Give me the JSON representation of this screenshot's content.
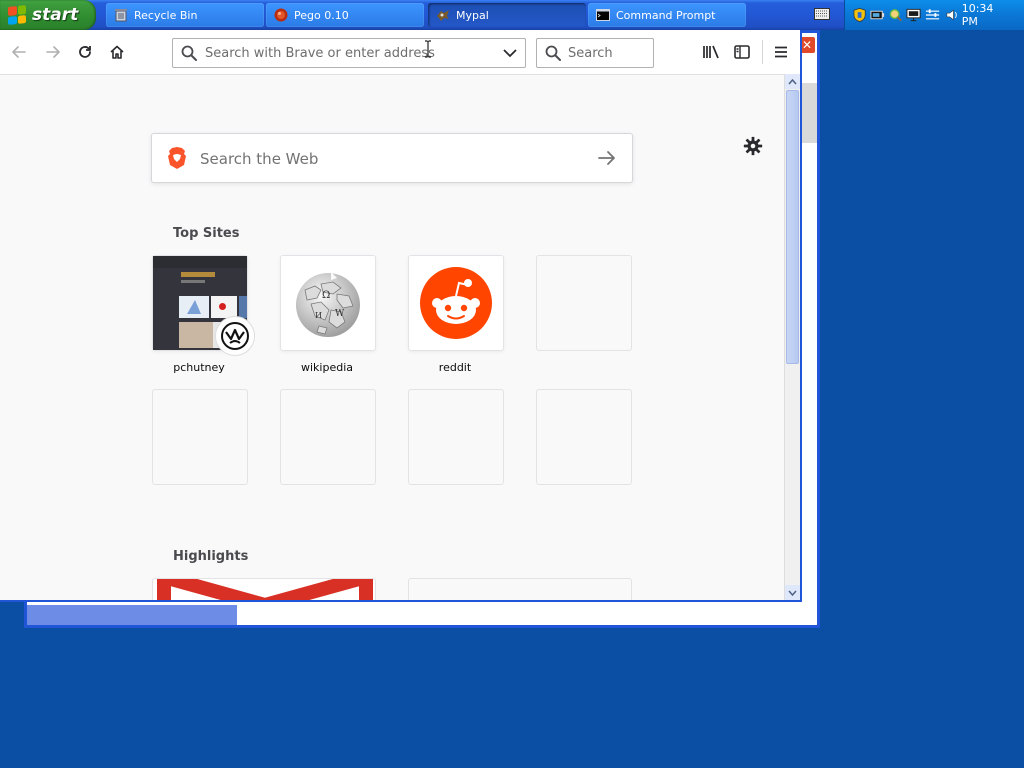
{
  "taskbar": {
    "start_label": "start",
    "tasks": [
      {
        "label": "Recycle Bin",
        "icon": "recycle-bin-icon",
        "active": false
      },
      {
        "label": "Pego 0.10",
        "icon": "pego-icon",
        "active": false
      },
      {
        "label": "Mypal",
        "icon": "mypal-icon",
        "active": true
      },
      {
        "label": "Command Prompt",
        "icon": "cmd-icon",
        "active": false
      }
    ],
    "clock": "10:34 PM"
  },
  "browser": {
    "urlbar_placeholder": "Search with Brave or enter address",
    "searchbar_placeholder": "Search",
    "websearch_placeholder": "Search the Web",
    "top_sites_title": "Top Sites",
    "highlights_title": "Highlights",
    "top_sites": [
      {
        "label": "pchutney"
      },
      {
        "label": "wikipedia"
      },
      {
        "label": "reddit"
      },
      {
        "label": ""
      }
    ]
  },
  "colors": {
    "desktop": "#0a4fa3",
    "taskbar_blue": "#245edb",
    "start_green": "#3c9a3c",
    "reddit_orange": "#ff4500",
    "brave_orange": "#fb542b",
    "gmail_red": "#d93025"
  }
}
